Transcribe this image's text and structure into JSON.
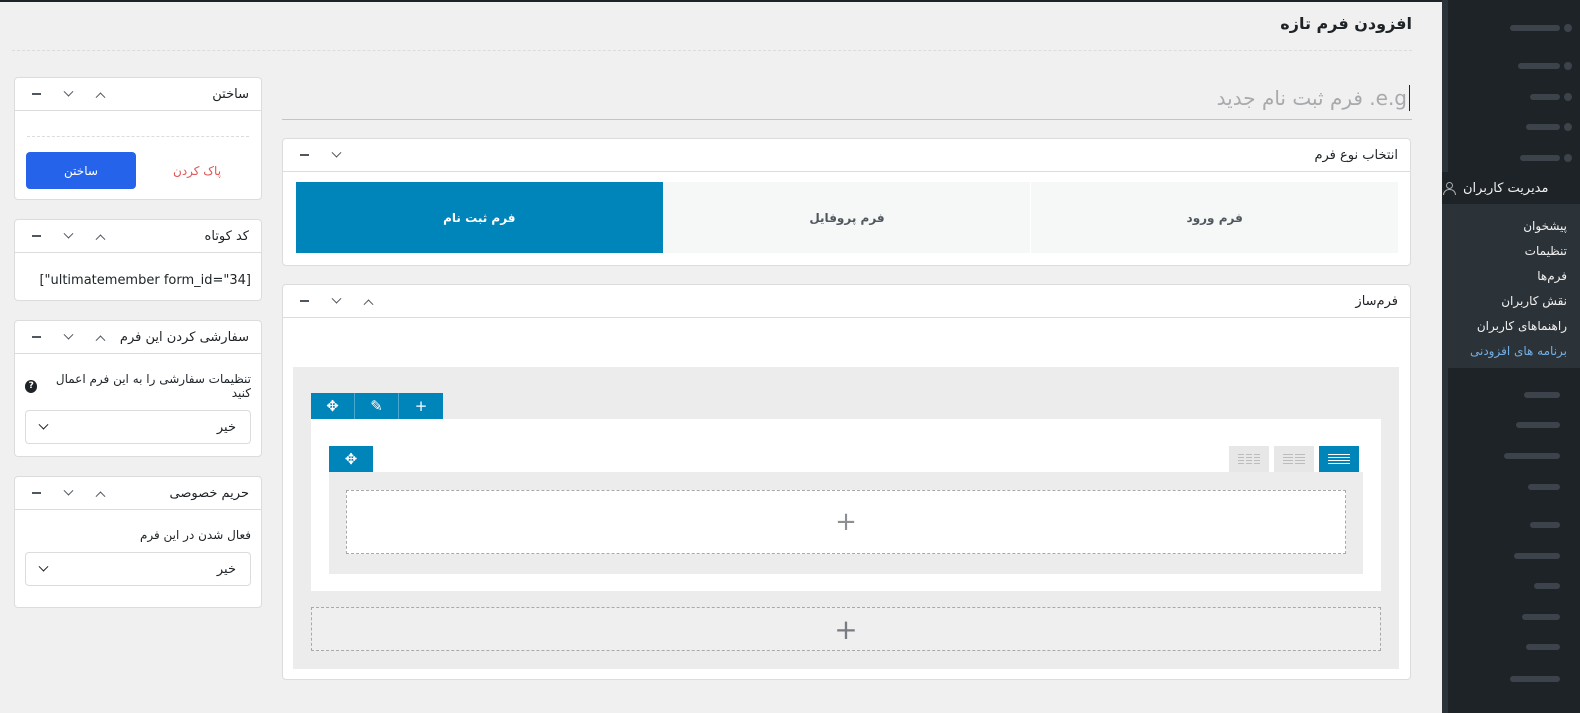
{
  "page": {
    "title": "افزودن فرم تازه",
    "form_title_placeholder": "e.g. فرم ثبت نام جدید"
  },
  "admin_menu": {
    "section_title": "مدیریت کاربران",
    "items": [
      {
        "label": "پیشخوان"
      },
      {
        "label": "تنظیمات"
      },
      {
        "label": "فرم‌ها"
      },
      {
        "label": "نقش کاربران"
      },
      {
        "label": "راهنماهای کاربران"
      },
      {
        "label": "برنامه های افزودنی",
        "active": true
      }
    ]
  },
  "form_type_box": {
    "title": "انتخاب نوع فرم",
    "types": [
      {
        "label": "فرم ورود",
        "active": false
      },
      {
        "label": "فرم پروفایل",
        "active": false
      },
      {
        "label": "فرم ثبت نام",
        "active": true
      }
    ]
  },
  "builder_box": {
    "title": "فرم‌ساز"
  },
  "create_box": {
    "title": "ساختن",
    "create_label": "ساختن",
    "clear_label": "پاک کردن"
  },
  "shortcode_box": {
    "title": "کد کوتاه",
    "value": "[\"ultimatemember form_id=\"34]"
  },
  "customize_box": {
    "title": "سفارشی کردن این فرم",
    "field_label": "تنظیمات سفارشی را به این فرم اعمال کنید",
    "value": "خیر"
  },
  "privacy_box": {
    "title": "حریم خصوصی",
    "field_label": "فعال شدن در این فرم",
    "value": "خیر"
  },
  "colors": {
    "accent": "#0085ba",
    "primary_button": "#2563eb",
    "sidebar_bg": "#1d2327",
    "menu_active": "#72aee6"
  }
}
